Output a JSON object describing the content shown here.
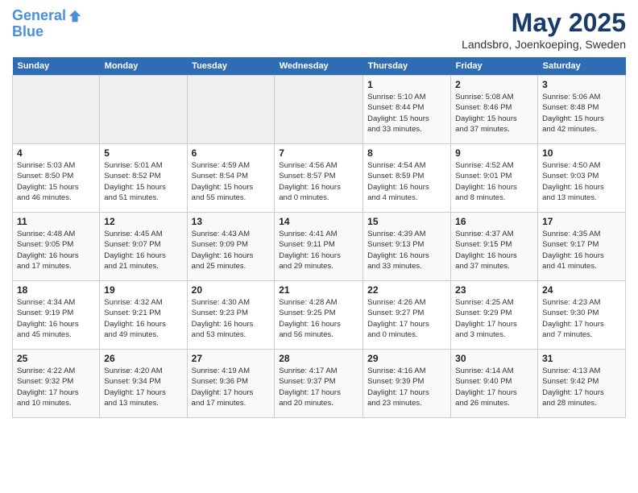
{
  "header": {
    "logo_line1": "General",
    "logo_line2": "Blue",
    "month_title": "May 2025",
    "location": "Landsbro, Joenkoeping, Sweden"
  },
  "days_of_week": [
    "Sunday",
    "Monday",
    "Tuesday",
    "Wednesday",
    "Thursday",
    "Friday",
    "Saturday"
  ],
  "weeks": [
    [
      {
        "day": "",
        "info": ""
      },
      {
        "day": "",
        "info": ""
      },
      {
        "day": "",
        "info": ""
      },
      {
        "day": "",
        "info": ""
      },
      {
        "day": "1",
        "info": "Sunrise: 5:10 AM\nSunset: 8:44 PM\nDaylight: 15 hours\nand 33 minutes."
      },
      {
        "day": "2",
        "info": "Sunrise: 5:08 AM\nSunset: 8:46 PM\nDaylight: 15 hours\nand 37 minutes."
      },
      {
        "day": "3",
        "info": "Sunrise: 5:06 AM\nSunset: 8:48 PM\nDaylight: 15 hours\nand 42 minutes."
      }
    ],
    [
      {
        "day": "4",
        "info": "Sunrise: 5:03 AM\nSunset: 8:50 PM\nDaylight: 15 hours\nand 46 minutes."
      },
      {
        "day": "5",
        "info": "Sunrise: 5:01 AM\nSunset: 8:52 PM\nDaylight: 15 hours\nand 51 minutes."
      },
      {
        "day": "6",
        "info": "Sunrise: 4:59 AM\nSunset: 8:54 PM\nDaylight: 15 hours\nand 55 minutes."
      },
      {
        "day": "7",
        "info": "Sunrise: 4:56 AM\nSunset: 8:57 PM\nDaylight: 16 hours\nand 0 minutes."
      },
      {
        "day": "8",
        "info": "Sunrise: 4:54 AM\nSunset: 8:59 PM\nDaylight: 16 hours\nand 4 minutes."
      },
      {
        "day": "9",
        "info": "Sunrise: 4:52 AM\nSunset: 9:01 PM\nDaylight: 16 hours\nand 8 minutes."
      },
      {
        "day": "10",
        "info": "Sunrise: 4:50 AM\nSunset: 9:03 PM\nDaylight: 16 hours\nand 13 minutes."
      }
    ],
    [
      {
        "day": "11",
        "info": "Sunrise: 4:48 AM\nSunset: 9:05 PM\nDaylight: 16 hours\nand 17 minutes."
      },
      {
        "day": "12",
        "info": "Sunrise: 4:45 AM\nSunset: 9:07 PM\nDaylight: 16 hours\nand 21 minutes."
      },
      {
        "day": "13",
        "info": "Sunrise: 4:43 AM\nSunset: 9:09 PM\nDaylight: 16 hours\nand 25 minutes."
      },
      {
        "day": "14",
        "info": "Sunrise: 4:41 AM\nSunset: 9:11 PM\nDaylight: 16 hours\nand 29 minutes."
      },
      {
        "day": "15",
        "info": "Sunrise: 4:39 AM\nSunset: 9:13 PM\nDaylight: 16 hours\nand 33 minutes."
      },
      {
        "day": "16",
        "info": "Sunrise: 4:37 AM\nSunset: 9:15 PM\nDaylight: 16 hours\nand 37 minutes."
      },
      {
        "day": "17",
        "info": "Sunrise: 4:35 AM\nSunset: 9:17 PM\nDaylight: 16 hours\nand 41 minutes."
      }
    ],
    [
      {
        "day": "18",
        "info": "Sunrise: 4:34 AM\nSunset: 9:19 PM\nDaylight: 16 hours\nand 45 minutes."
      },
      {
        "day": "19",
        "info": "Sunrise: 4:32 AM\nSunset: 9:21 PM\nDaylight: 16 hours\nand 49 minutes."
      },
      {
        "day": "20",
        "info": "Sunrise: 4:30 AM\nSunset: 9:23 PM\nDaylight: 16 hours\nand 53 minutes."
      },
      {
        "day": "21",
        "info": "Sunrise: 4:28 AM\nSunset: 9:25 PM\nDaylight: 16 hours\nand 56 minutes."
      },
      {
        "day": "22",
        "info": "Sunrise: 4:26 AM\nSunset: 9:27 PM\nDaylight: 17 hours\nand 0 minutes."
      },
      {
        "day": "23",
        "info": "Sunrise: 4:25 AM\nSunset: 9:29 PM\nDaylight: 17 hours\nand 3 minutes."
      },
      {
        "day": "24",
        "info": "Sunrise: 4:23 AM\nSunset: 9:30 PM\nDaylight: 17 hours\nand 7 minutes."
      }
    ],
    [
      {
        "day": "25",
        "info": "Sunrise: 4:22 AM\nSunset: 9:32 PM\nDaylight: 17 hours\nand 10 minutes."
      },
      {
        "day": "26",
        "info": "Sunrise: 4:20 AM\nSunset: 9:34 PM\nDaylight: 17 hours\nand 13 minutes."
      },
      {
        "day": "27",
        "info": "Sunrise: 4:19 AM\nSunset: 9:36 PM\nDaylight: 17 hours\nand 17 minutes."
      },
      {
        "day": "28",
        "info": "Sunrise: 4:17 AM\nSunset: 9:37 PM\nDaylight: 17 hours\nand 20 minutes."
      },
      {
        "day": "29",
        "info": "Sunrise: 4:16 AM\nSunset: 9:39 PM\nDaylight: 17 hours\nand 23 minutes."
      },
      {
        "day": "30",
        "info": "Sunrise: 4:14 AM\nSunset: 9:40 PM\nDaylight: 17 hours\nand 26 minutes."
      },
      {
        "day": "31",
        "info": "Sunrise: 4:13 AM\nSunset: 9:42 PM\nDaylight: 17 hours\nand 28 minutes."
      }
    ]
  ]
}
